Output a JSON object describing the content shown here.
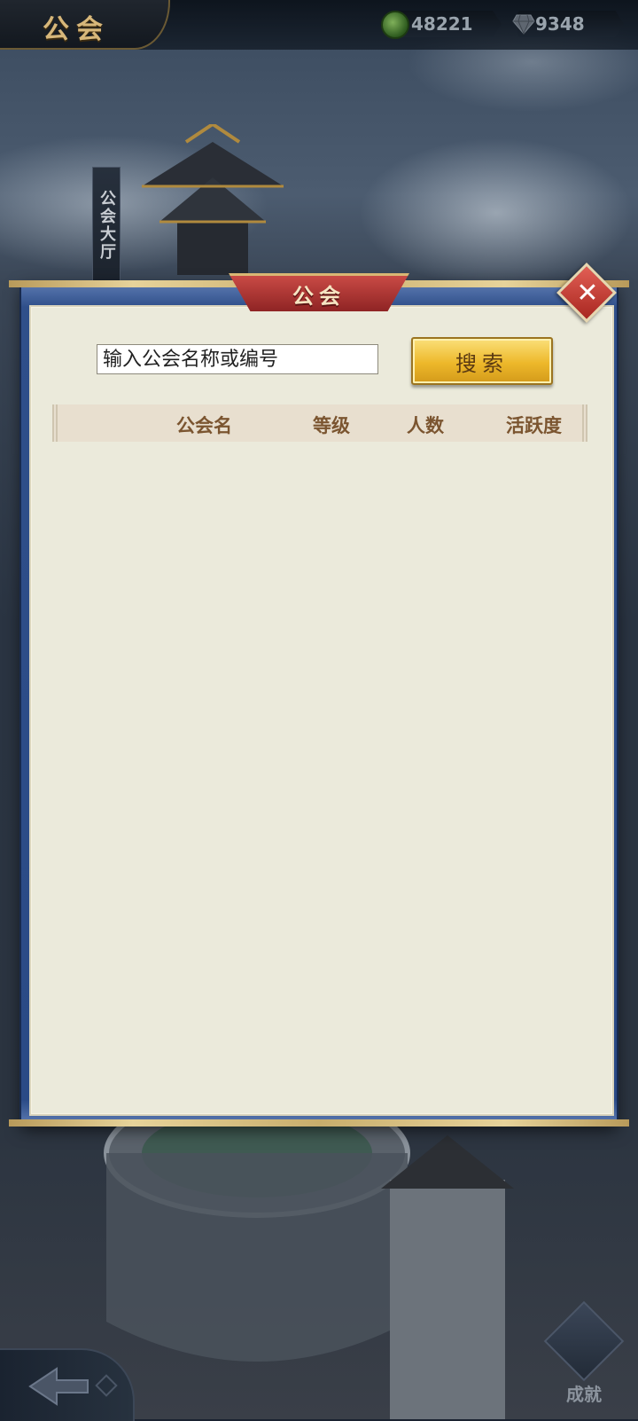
{
  "top_bar": {
    "title": "公会",
    "jade_amount": "48221",
    "gem_amount": "9348",
    "icons": [
      "jade-icon",
      "gem-icon"
    ]
  },
  "background": {
    "hall_sign": "公会大厅"
  },
  "dialog": {
    "title": "公会",
    "close_icon": "close-icon",
    "search": {
      "placeholder": "输入公会名称或编号",
      "value": "",
      "button_label": "搜索"
    },
    "table": {
      "columns": [
        "公会名",
        "等级",
        "人数",
        "活跃度"
      ],
      "rows": []
    }
  },
  "bottom": {
    "back_icon": "back-arrow-icon",
    "achievement_label": "成就"
  },
  "colors": {
    "panel_bg": "#ebeadb",
    "frame_blue": "#2f4f8a",
    "title_red": "#a82720",
    "button_gold": "#edb82a",
    "header_text": "#7b5530"
  }
}
